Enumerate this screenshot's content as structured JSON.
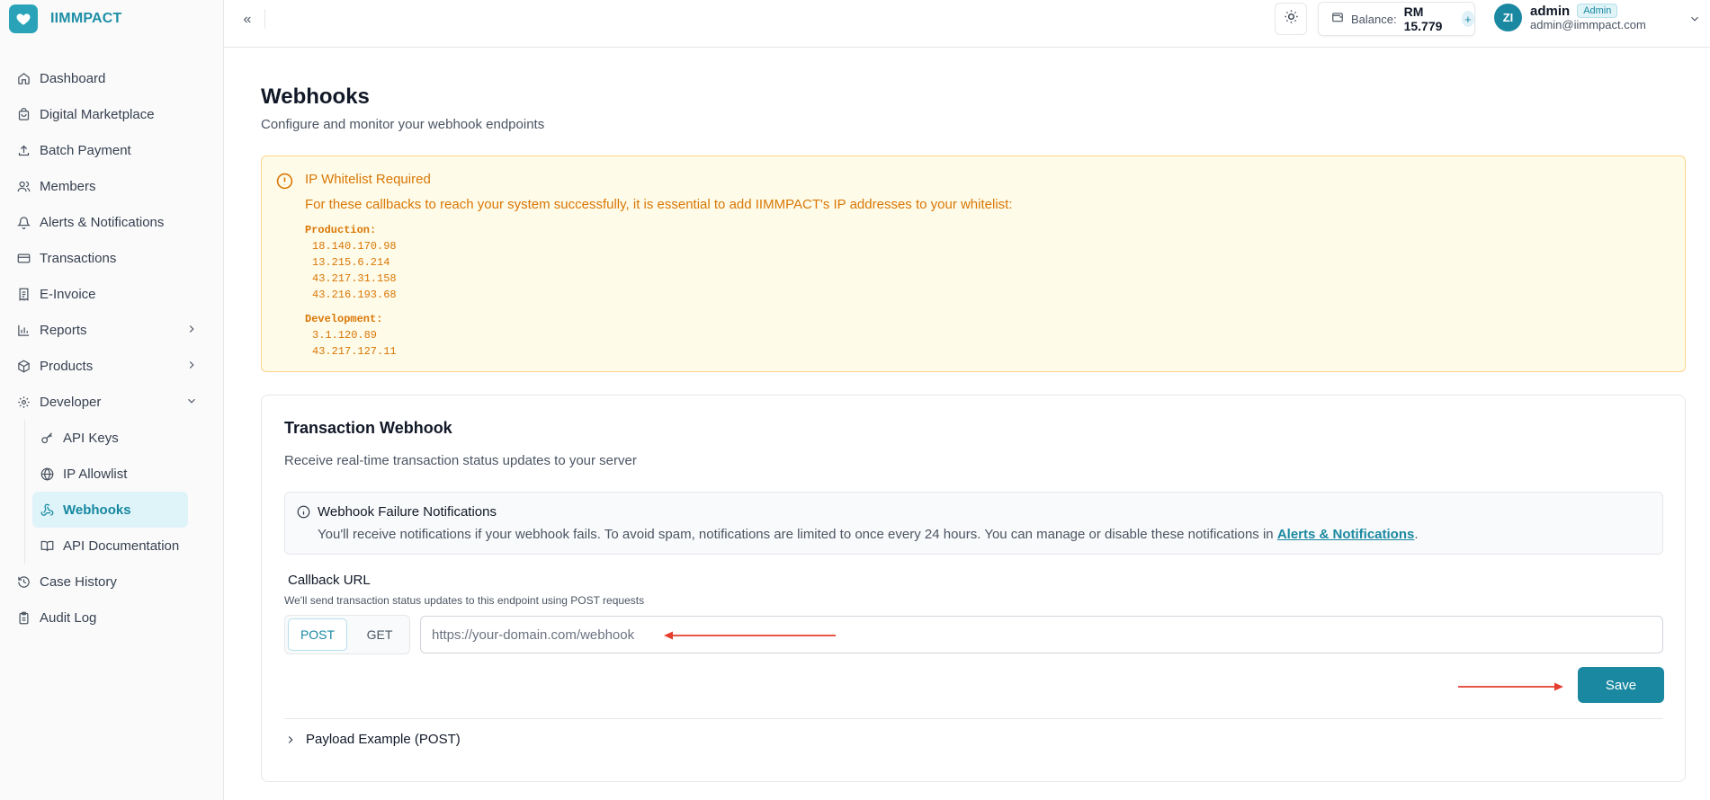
{
  "brand": {
    "name": "IIMMPACT"
  },
  "sidebar": {
    "items": [
      {
        "label": "Dashboard",
        "icon": "home-icon"
      },
      {
        "label": "Digital Marketplace",
        "icon": "shopping-bag-icon"
      },
      {
        "label": "Batch Payment",
        "icon": "upload-icon"
      },
      {
        "label": "Members",
        "icon": "users-icon"
      },
      {
        "label": "Alerts & Notifications",
        "icon": "bell-icon"
      },
      {
        "label": "Transactions",
        "icon": "credit-card-icon"
      },
      {
        "label": "E-Invoice",
        "icon": "receipt-icon"
      },
      {
        "label": "Reports",
        "icon": "bar-chart-icon"
      },
      {
        "label": "Products",
        "icon": "package-icon"
      },
      {
        "label": "Developer",
        "icon": "gear-icon"
      }
    ],
    "developer_sub": [
      {
        "label": "API Keys",
        "icon": "key-icon"
      },
      {
        "label": "IP Allowlist",
        "icon": "globe-icon"
      },
      {
        "label": "Webhooks",
        "icon": "webhook-icon",
        "active": true
      },
      {
        "label": "API Documentation",
        "icon": "book-open-icon"
      }
    ],
    "bottom": [
      {
        "label": "Case History",
        "icon": "history-icon"
      },
      {
        "label": "Audit Log",
        "icon": "clipboard-icon"
      }
    ]
  },
  "header": {
    "collapse_glyph": "«",
    "balance_label": "Balance:",
    "balance_value": "RM 15.779",
    "balance_plus": "+",
    "user_initials": "ZI",
    "user_name": "admin",
    "user_role": "Admin",
    "user_email": "admin@iimmpact.com"
  },
  "page": {
    "title": "Webhooks",
    "subtitle": "Configure and monitor your webhook endpoints"
  },
  "alert": {
    "title": "IP Whitelist Required",
    "description": "For these callbacks to reach your system successfully, it is essential to add IIMMPACT's IP addresses to your whitelist:",
    "production_label": "Production:",
    "production_ips": [
      "18.140.170.98",
      "13.215.6.214",
      "43.217.31.158",
      "43.216.193.68"
    ],
    "development_label": "Development:",
    "development_ips": [
      "3.1.120.89",
      "43.217.127.11"
    ]
  },
  "webhook_card": {
    "title": "Transaction Webhook",
    "subtitle": "Receive real-time transaction status updates to your server",
    "notice_title": "Webhook Failure Notifications",
    "notice_text": "You'll receive notifications if your webhook fails. To avoid spam, notifications are limited to once every 24 hours. You can manage or disable these notifications in ",
    "notice_link": "Alerts & Notifications",
    "notice_end": ".",
    "callback_label": "Callback URL",
    "callback_hint": "We'll send transaction status updates to this endpoint using POST requests",
    "method_post": "POST",
    "method_get": "GET",
    "url_placeholder": "https://your-domain.com/webhook",
    "url_value": "",
    "save_label": "Save",
    "payload_label": "Payload Example (POST)"
  },
  "colors": {
    "accent": "#1a88a1",
    "alert_text": "#d97706",
    "alert_bg": "#fefbe8",
    "arrow": "#e53e2e"
  }
}
